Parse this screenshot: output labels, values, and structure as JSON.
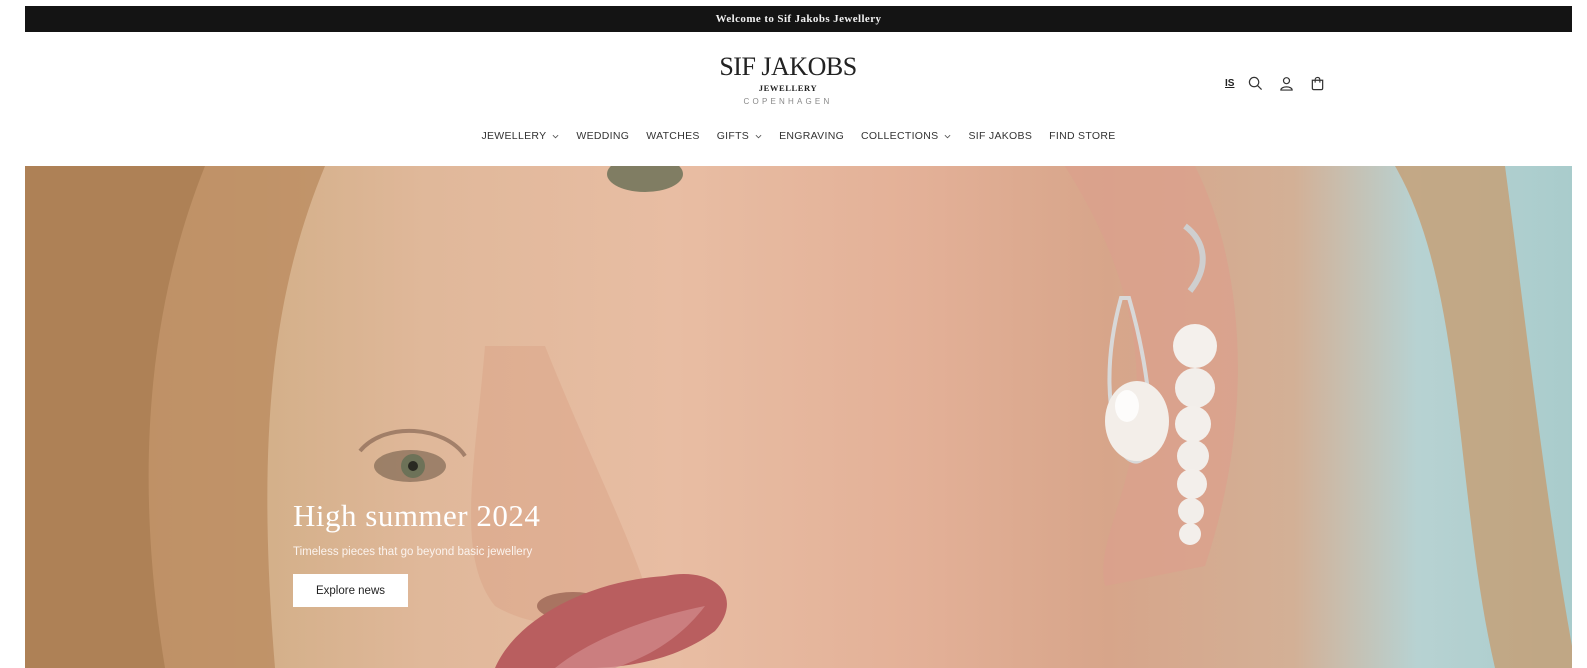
{
  "announcement": {
    "text": "Welcome to Sif Jakobs Jewellery"
  },
  "logo": {
    "main": "SIF JAKOBS",
    "sub": "JEWELLERY",
    "city": "COPENHAGEN"
  },
  "header_icons": {
    "language": "IS",
    "search_icon": "search-icon",
    "account_icon": "user-icon",
    "cart_icon": "bag-icon"
  },
  "nav": {
    "items": [
      {
        "label": "JEWELLERY",
        "has_dropdown": true
      },
      {
        "label": "WEDDING",
        "has_dropdown": false
      },
      {
        "label": "WATCHES",
        "has_dropdown": false
      },
      {
        "label": "GIFTS",
        "has_dropdown": true
      },
      {
        "label": "ENGRAVING",
        "has_dropdown": false
      },
      {
        "label": "COLLECTIONS",
        "has_dropdown": true
      },
      {
        "label": "SIF JAKOBS",
        "has_dropdown": false
      },
      {
        "label": "FIND STORE",
        "has_dropdown": false
      }
    ]
  },
  "hero": {
    "title": "High summer 2024",
    "subtitle": "Timeless pieces that go beyond basic jewellery",
    "button_label": "Explore news"
  },
  "colors": {
    "announcement_bg": "#141414",
    "hero_bg_teal": "#a9cccc"
  }
}
